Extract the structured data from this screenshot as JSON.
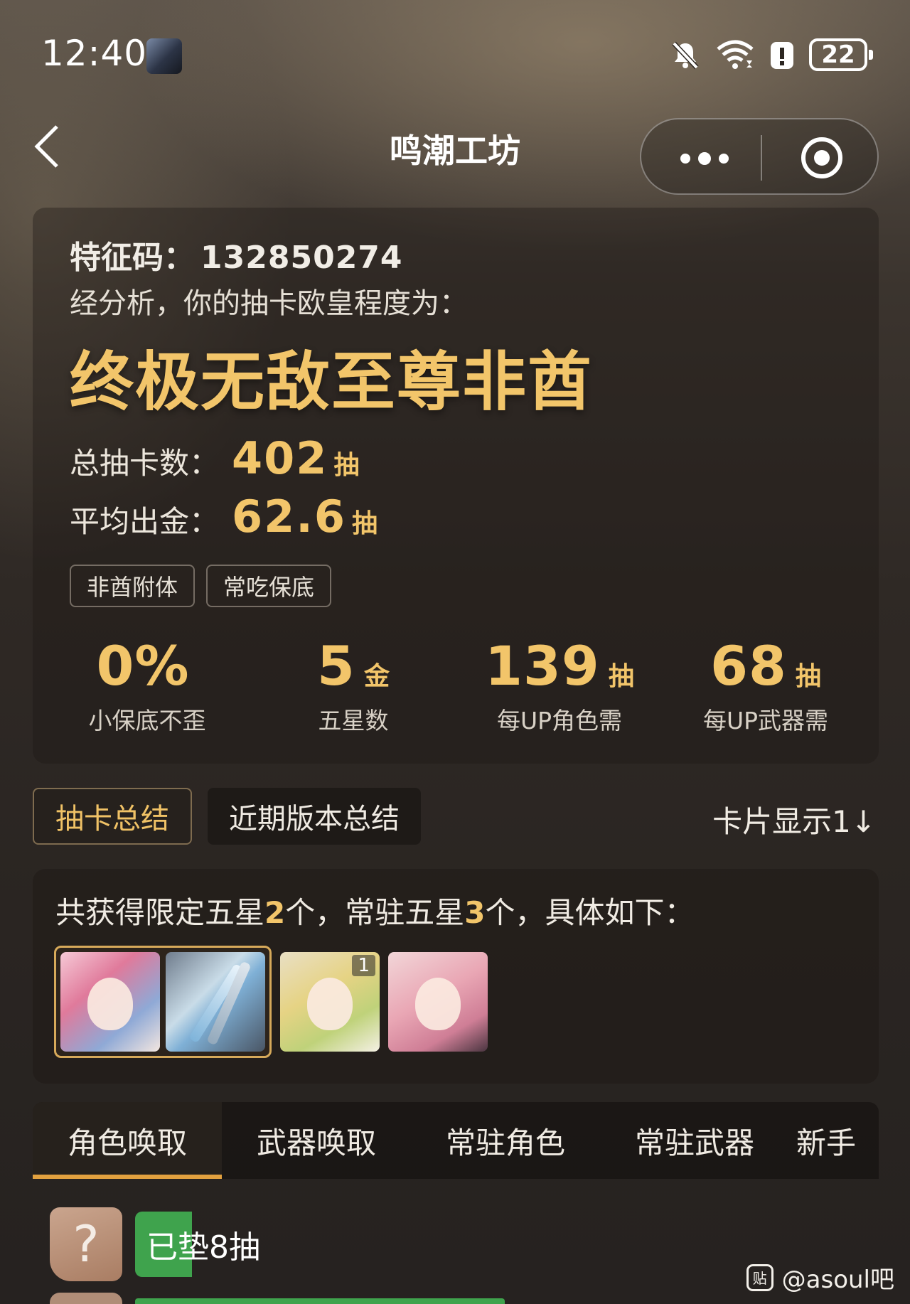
{
  "status_bar": {
    "time": "12:40",
    "battery": "22",
    "icons": [
      "avatar-icon",
      "bell-off-icon",
      "wifi-icon",
      "alert-icon",
      "battery-icon"
    ]
  },
  "nav": {
    "title": "鸣潮工坊",
    "back_icon": "chevron-left-icon",
    "more_icon": "more-dots-icon",
    "close_icon": "target-circle-icon"
  },
  "summary": {
    "code_label": "特征码：",
    "code_value": "132850274",
    "analysis_text": "经分析，你的抽卡欧皇程度为：",
    "rank_title": "终极无敌至尊非酋",
    "total_label": "总抽卡数：",
    "total_value": "402",
    "total_unit": "抽",
    "avg_label": "平均出金：",
    "avg_value": "62.6",
    "avg_unit": "抽",
    "tags": [
      "非酋附体",
      "常吃保底"
    ],
    "metrics": [
      {
        "value": "0%",
        "unit": "",
        "label": "小保底不歪"
      },
      {
        "value": "5",
        "unit": "金",
        "label": "五星数"
      },
      {
        "value": "139",
        "unit": "抽",
        "label": "每UP角色需"
      },
      {
        "value": "68",
        "unit": "抽",
        "label": "每UP武器需"
      }
    ]
  },
  "section_tabs": {
    "tabs": [
      "抽卡总结",
      "近期版本总结"
    ],
    "active": 0,
    "card_toggle": "卡片显示1↓"
  },
  "five_star": {
    "prefix": "共获得限定五星",
    "limited_count": "2",
    "mid": "个，常驻五星",
    "standard_count": "3",
    "suffix": "个，具体如下：",
    "thumb_badge": "1"
  },
  "pool_tabs": {
    "tabs": [
      "角色唤取",
      "武器唤取",
      "常驻角色",
      "常驻武器",
      "新手"
    ],
    "active": 0
  },
  "pity": {
    "avatar_text": "?",
    "text": "已垫8抽"
  },
  "watermark": {
    "logo": "贴",
    "text": "@asoul吧"
  },
  "colors": {
    "accent_gold": "#f2c56a",
    "tab_indicator": "#e2a13f",
    "pity_green": "#3fa34d"
  }
}
